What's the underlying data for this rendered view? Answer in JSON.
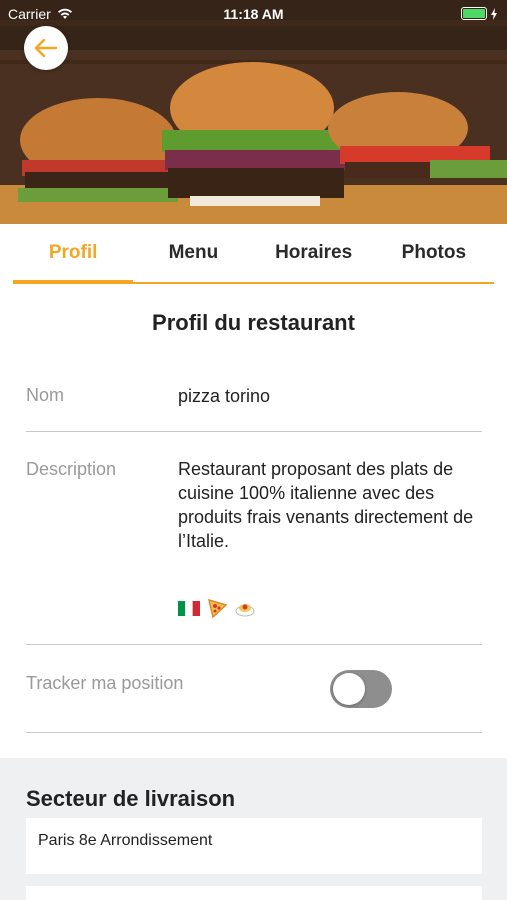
{
  "status_bar": {
    "carrier": "Carrier",
    "time": "11:18 AM"
  },
  "hero": {
    "image": "burgers-photo"
  },
  "tabs": [
    {
      "label": "Profil",
      "active": true
    },
    {
      "label": "Menu",
      "active": false
    },
    {
      "label": "Horaires",
      "active": false
    },
    {
      "label": "Photos",
      "active": false
    }
  ],
  "profile": {
    "title": "Profil du restaurant",
    "name_label": "Nom",
    "name_value": "pizza torino",
    "description_label": "Description",
    "description_value": "Restaurant proposant des plats de cuisine 100% italienne avec des produits frais venants directement de l’Italie.",
    "emojis": [
      "🇮🇹",
      "🍕",
      "🍝"
    ],
    "tracker_label": "Tracker ma position",
    "tracker_enabled": false
  },
  "delivery": {
    "title": "Secteur de livraison",
    "zones": [
      "Paris 8e Arrondissement",
      ""
    ]
  },
  "colors": {
    "accent": "#f5a623",
    "toggle_off": "#8e8e8e",
    "battery": "#4cd964"
  }
}
